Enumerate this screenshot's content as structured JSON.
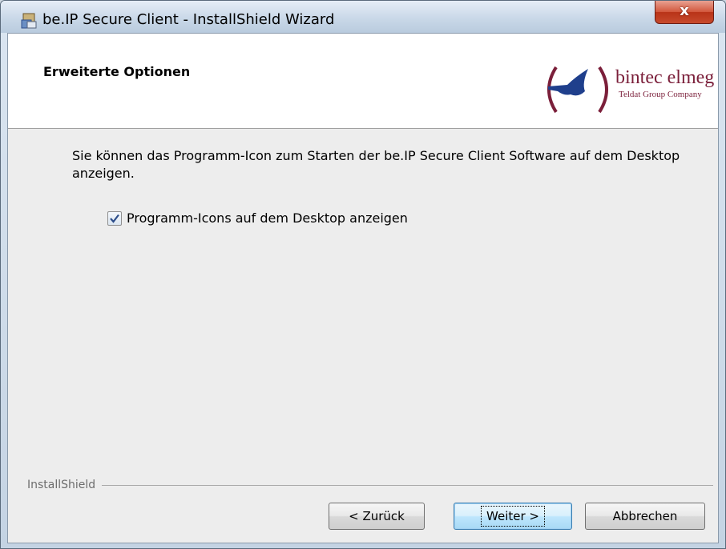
{
  "window": {
    "title": "be.IP Secure Client - InstallShield Wizard",
    "close_label": "x"
  },
  "header": {
    "title": "Erweiterte Optionen",
    "logo_brand": "bintec elmeg",
    "logo_sub": "Teldat Group Company"
  },
  "body": {
    "description": "Sie können das Programm-Icon zum Starten der be.IP Secure Client Software auf dem Desktop anzeigen.",
    "checkbox_label": "Programm-Icons auf dem Desktop anzeigen",
    "checkbox_checked": true
  },
  "footer": {
    "brand": "InstallShield",
    "back_label": "< Zurück",
    "next_label": "Weiter >",
    "cancel_label": "Abbrechen"
  },
  "colors": {
    "logo": "#7b1f3a",
    "close": "#c74a2c",
    "checkmark": "#2d4d8a"
  }
}
